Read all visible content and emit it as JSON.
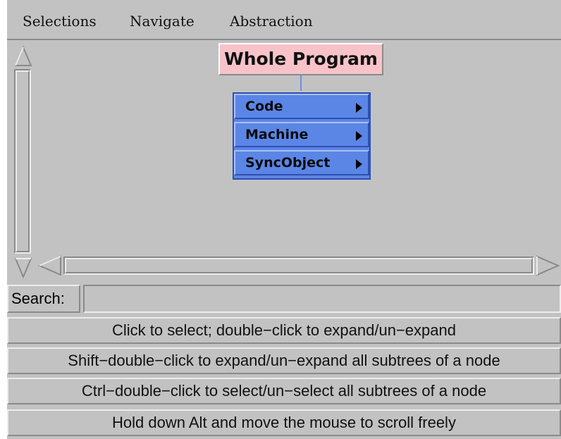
{
  "menubar": {
    "items": [
      "Selections",
      "Navigate",
      "Abstraction"
    ]
  },
  "tree": {
    "root_label": "Whole Program",
    "children": [
      {
        "label": "Code"
      },
      {
        "label": "Machine"
      },
      {
        "label": "SyncObject"
      }
    ]
  },
  "search": {
    "label": "Search:",
    "value": ""
  },
  "help": [
    "Click to select; double−click to expand/un−expand",
    "Shift−double−click to expand/un−expand all subtrees of a node",
    "Ctrl−double−click to select/un−select all subtrees of a node",
    "Hold down Alt and move the mouse to scroll freely"
  ],
  "colors": {
    "background": "#c2c2c2",
    "root_node": "#f7c3c9",
    "child_menu": "#5b86e6"
  },
  "icons": [
    "scroll-up-arrow-icon",
    "scroll-down-arrow-icon",
    "scroll-left-arrow-icon",
    "scroll-right-arrow-icon",
    "submenu-arrow-icon"
  ]
}
